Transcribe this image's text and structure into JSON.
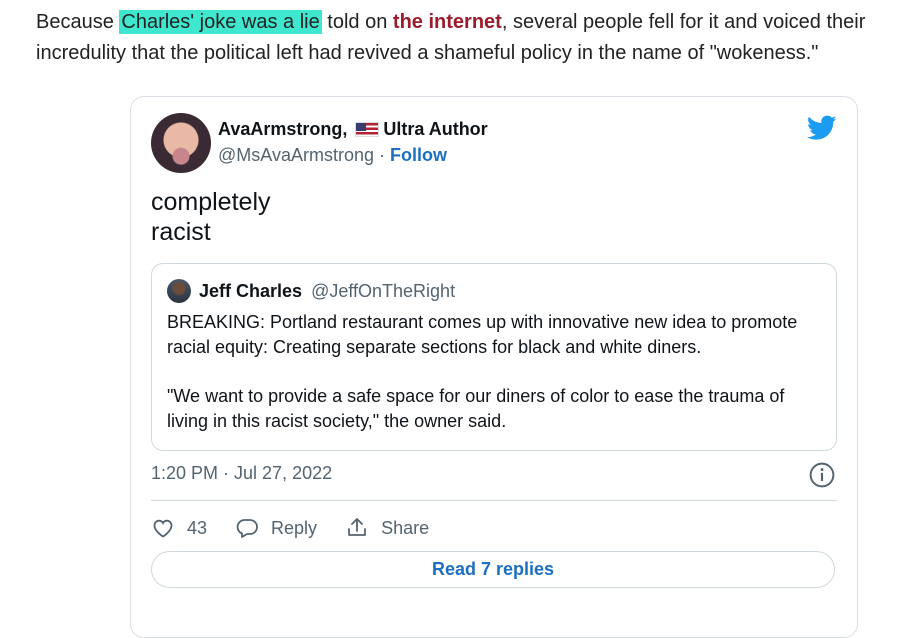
{
  "article": {
    "prefix": "Because ",
    "highlight": "Charles' joke was a lie",
    "middle": " told on ",
    "link": "the internet",
    "suffix": ", several people fell for it and voiced their",
    "line2": "incredulity that the political left had revived a shameful policy in the name of \"wokeness.\""
  },
  "tweet": {
    "author_name": "AvaArmstrong,",
    "author_name_suffix": "Ultra Author",
    "handle": "@MsAvaArmstrong",
    "separator": " · ",
    "follow_label": "Follow",
    "text_line1": "completely",
    "text_line2": "racist",
    "timestamp": "1:20 PM · Jul 27, 2022",
    "likes": "43",
    "reply_label": "Reply",
    "share_label": "Share",
    "read_replies_label": "Read 7 replies",
    "colors": {
      "link_blue": "#1d70c1",
      "twitter_blue": "#1d9bf0",
      "muted": "#536471"
    }
  },
  "quoted": {
    "author_name": "Jeff Charles",
    "handle": "@JeffOnTheRight",
    "paragraph1": "BREAKING: Portland restaurant comes up with innovative new idea to promote racial equity: Creating separate sections for black and white diners.",
    "paragraph2": "\"We want to provide a safe space for our diners of color to ease the trauma of living in this racist society,\" the owner said."
  },
  "icons": [
    "twitter-bird-icon",
    "us-flag-icon",
    "info-icon",
    "heart-icon",
    "reply-icon",
    "share-icon"
  ]
}
